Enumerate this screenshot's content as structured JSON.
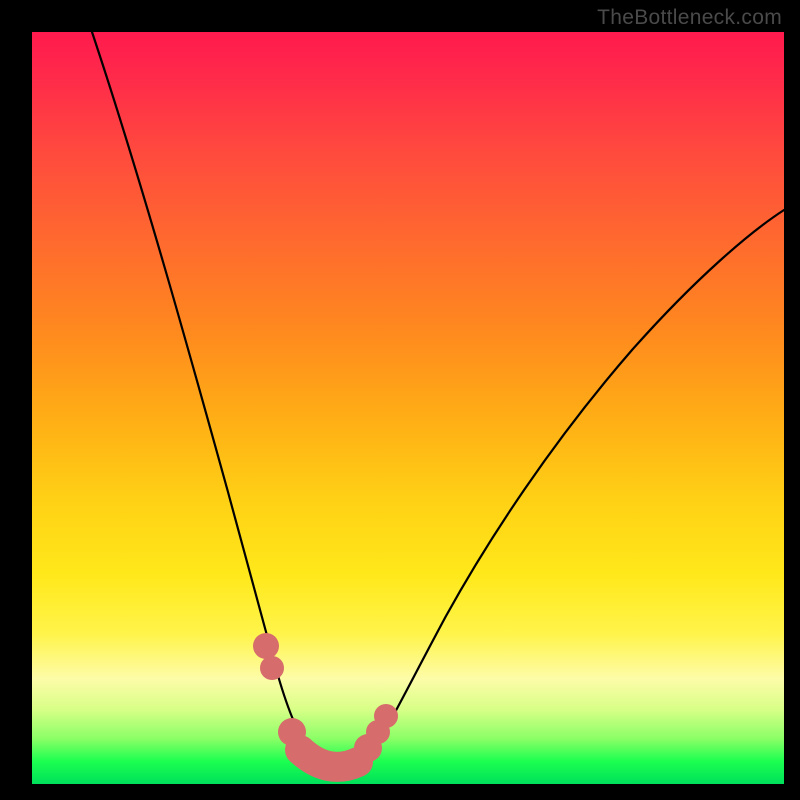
{
  "watermark": "TheBottleneck.com",
  "colors": {
    "page_bg": "#000000",
    "gradient_top": "#ff1a4d",
    "gradient_bottom": "#00e05a",
    "curve": "#000000",
    "marker": "#d66c6c"
  },
  "chart_data": {
    "type": "line",
    "title": "",
    "xlabel": "",
    "ylabel": "",
    "xlim": [
      0,
      100
    ],
    "ylim": [
      0,
      100
    ],
    "series": [
      {
        "name": "left-curve",
        "x": [
          8,
          12,
          16,
          20,
          23,
          26,
          28,
          30,
          31.5,
          33,
          34,
          35,
          36,
          38,
          40,
          42
        ],
        "values": [
          100,
          87,
          74,
          61,
          50,
          40,
          32,
          25,
          19,
          14,
          10,
          7,
          5,
          3,
          2,
          2
        ]
      },
      {
        "name": "right-curve",
        "x": [
          42,
          44,
          46,
          48,
          51,
          55,
          60,
          66,
          74,
          84,
          96,
          100
        ],
        "values": [
          2,
          3,
          5,
          8,
          12,
          18,
          26,
          35,
          46,
          58,
          71,
          76
        ]
      }
    ],
    "markers": {
      "name": "highlighted-points",
      "color": "#d66c6c",
      "points": [
        {
          "x": 31.0,
          "y": 18.0,
          "r": 1.8
        },
        {
          "x": 31.8,
          "y": 15.0,
          "r": 1.6
        },
        {
          "x": 34.5,
          "y": 5.0,
          "r": 2.0
        },
        {
          "x": 37.5,
          "y": 2.8,
          "r": 2.6
        },
        {
          "x": 40.0,
          "y": 2.2,
          "r": 2.6
        },
        {
          "x": 42.5,
          "y": 2.6,
          "r": 2.6
        },
        {
          "x": 44.5,
          "y": 4.0,
          "r": 2.0
        },
        {
          "x": 46.0,
          "y": 6.5,
          "r": 1.6
        },
        {
          "x": 47.0,
          "y": 9.0,
          "r": 1.6
        }
      ]
    }
  }
}
